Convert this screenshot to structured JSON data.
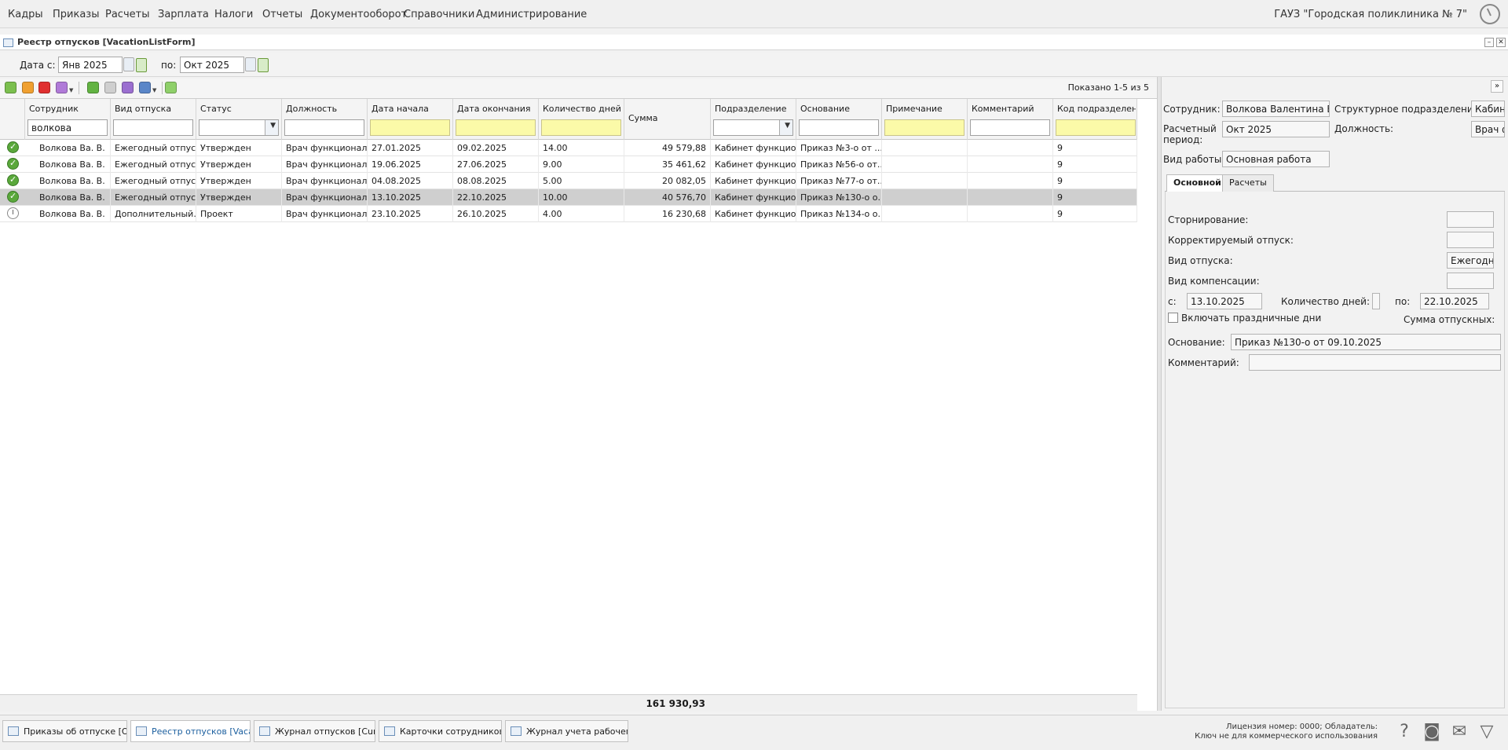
{
  "menu": {
    "items": [
      "Кадры",
      "Приказы",
      "Расчеты",
      "Зарплата",
      "Налоги",
      "Отчеты",
      "Документооборот",
      "Справочники",
      "Администрирование"
    ],
    "org": "ГАУЗ \"Городская поликлиника № 7\""
  },
  "window": {
    "title": "Реестр отпусков [VacationListForm]"
  },
  "datebar": {
    "from_label": "Дата с:",
    "from_value": "Янв 2025",
    "to_label": "по:",
    "to_value": "Окт 2025"
  },
  "toolbar": {
    "shown": "Показано 1-5 из 5"
  },
  "grid": {
    "columns": [
      "Сотрудник",
      "Вид отпуска",
      "Статус",
      "Должность",
      "Дата начала",
      "Дата окончания",
      "Количество дней",
      "Сумма",
      "Подразделение",
      "Основание",
      "Примечание",
      "Комментарий",
      "Код подразделен..."
    ],
    "filter_employee": "волкова",
    "rows": [
      {
        "status_icon": "approved",
        "employee": "Волкова Ва. В.",
        "type": "Ежегодный отпуск",
        "status": "Утвержден",
        "position": "Врач функционал...",
        "start": "27.01.2025",
        "end": "09.02.2025",
        "days": "14.00",
        "sum": "49 579,88",
        "dept": "Кабинет функцио...",
        "basis": "Приказ №3-о от ...",
        "note": "",
        "comment": "",
        "code": "9",
        "selected": false
      },
      {
        "status_icon": "approved",
        "employee": "Волкова Ва. В.",
        "type": "Ежегодный отпуск",
        "status": "Утвержден",
        "position": "Врач функционал...",
        "start": "19.06.2025",
        "end": "27.06.2025",
        "days": "9.00",
        "sum": "35 461,62",
        "dept": "Кабинет функцио...",
        "basis": "Приказ №56-о от...",
        "note": "",
        "comment": "",
        "code": "9",
        "selected": false
      },
      {
        "status_icon": "approved",
        "employee": "Волкова Ва. В.",
        "type": "Ежегодный отпуск",
        "status": "Утвержден",
        "position": "Врач функционал...",
        "start": "04.08.2025",
        "end": "08.08.2025",
        "days": "5.00",
        "sum": "20 082,05",
        "dept": "Кабинет функцио...",
        "basis": "Приказ №77-о от...",
        "note": "",
        "comment": "",
        "code": "9",
        "selected": false
      },
      {
        "status_icon": "approved",
        "employee": "Волкова Ва. В.",
        "type": "Ежегодный отпуск",
        "status": "Утвержден",
        "position": "Врач функционал...",
        "start": "13.10.2025",
        "end": "22.10.2025",
        "days": "10.00",
        "sum": "40 576,70",
        "dept": "Кабинет функцио...",
        "basis": "Приказ №130-о о...",
        "note": "",
        "comment": "",
        "code": "9",
        "selected": true
      },
      {
        "status_icon": "project",
        "employee": "Волкова Ва. В.",
        "type": "Дополнительный...",
        "status": "Проект",
        "position": "Врач функционал...",
        "start": "23.10.2025",
        "end": "26.10.2025",
        "days": "4.00",
        "sum": "16 230,68",
        "dept": "Кабинет функцио...",
        "basis": "Приказ №134-о о...",
        "note": "",
        "comment": "",
        "code": "9",
        "selected": false
      }
    ],
    "total": "161 930,93"
  },
  "details": {
    "employee_label": "Сотрудник:",
    "employee_value": "Волкова Валентина Вал",
    "dept_label": "Структурное подразделение:",
    "dept_value": "Кабин",
    "period_label_1": "Расчетный",
    "period_label_2": "период:",
    "period_value": "Окт 2025",
    "position_label": "Должность:",
    "position_value": "Врач ф",
    "worktype_label": "Вид работы:",
    "worktype_value": "Основная работа",
    "tabs": [
      "Основной",
      "Расчеты"
    ],
    "storno_label": "Сторнирование:",
    "corrected_label": "Корректируемый отпуск:",
    "vtype_label": "Вид отпуска:",
    "vtype_value": "Ежегодны",
    "comp_label": "Вид компенсации:",
    "from_label": "с:",
    "from_value": "13.10.2025",
    "days_label": "Количество дней:",
    "to_label": "по:",
    "to_value": "22.10.2025",
    "holidays_label": "Включать праздничные дни",
    "sum_label": "Сумма отпускных:",
    "basis_label": "Основание:",
    "basis_value": "Приказ №130-о от 09.10.2025",
    "comment_label": "Комментарий:"
  },
  "taskbar": {
    "tabs": [
      "Приказы об отпуске [Or...",
      "Реестр отпусков [Vacat...",
      "Журнал отпусков [Curr...",
      "Карточки сотрудников [...",
      "Журнал учета рабочего ..."
    ],
    "license_1": "Лицензия номер: 0000; Обладатель:",
    "license_2": "Ключ не для коммерческого использования"
  }
}
